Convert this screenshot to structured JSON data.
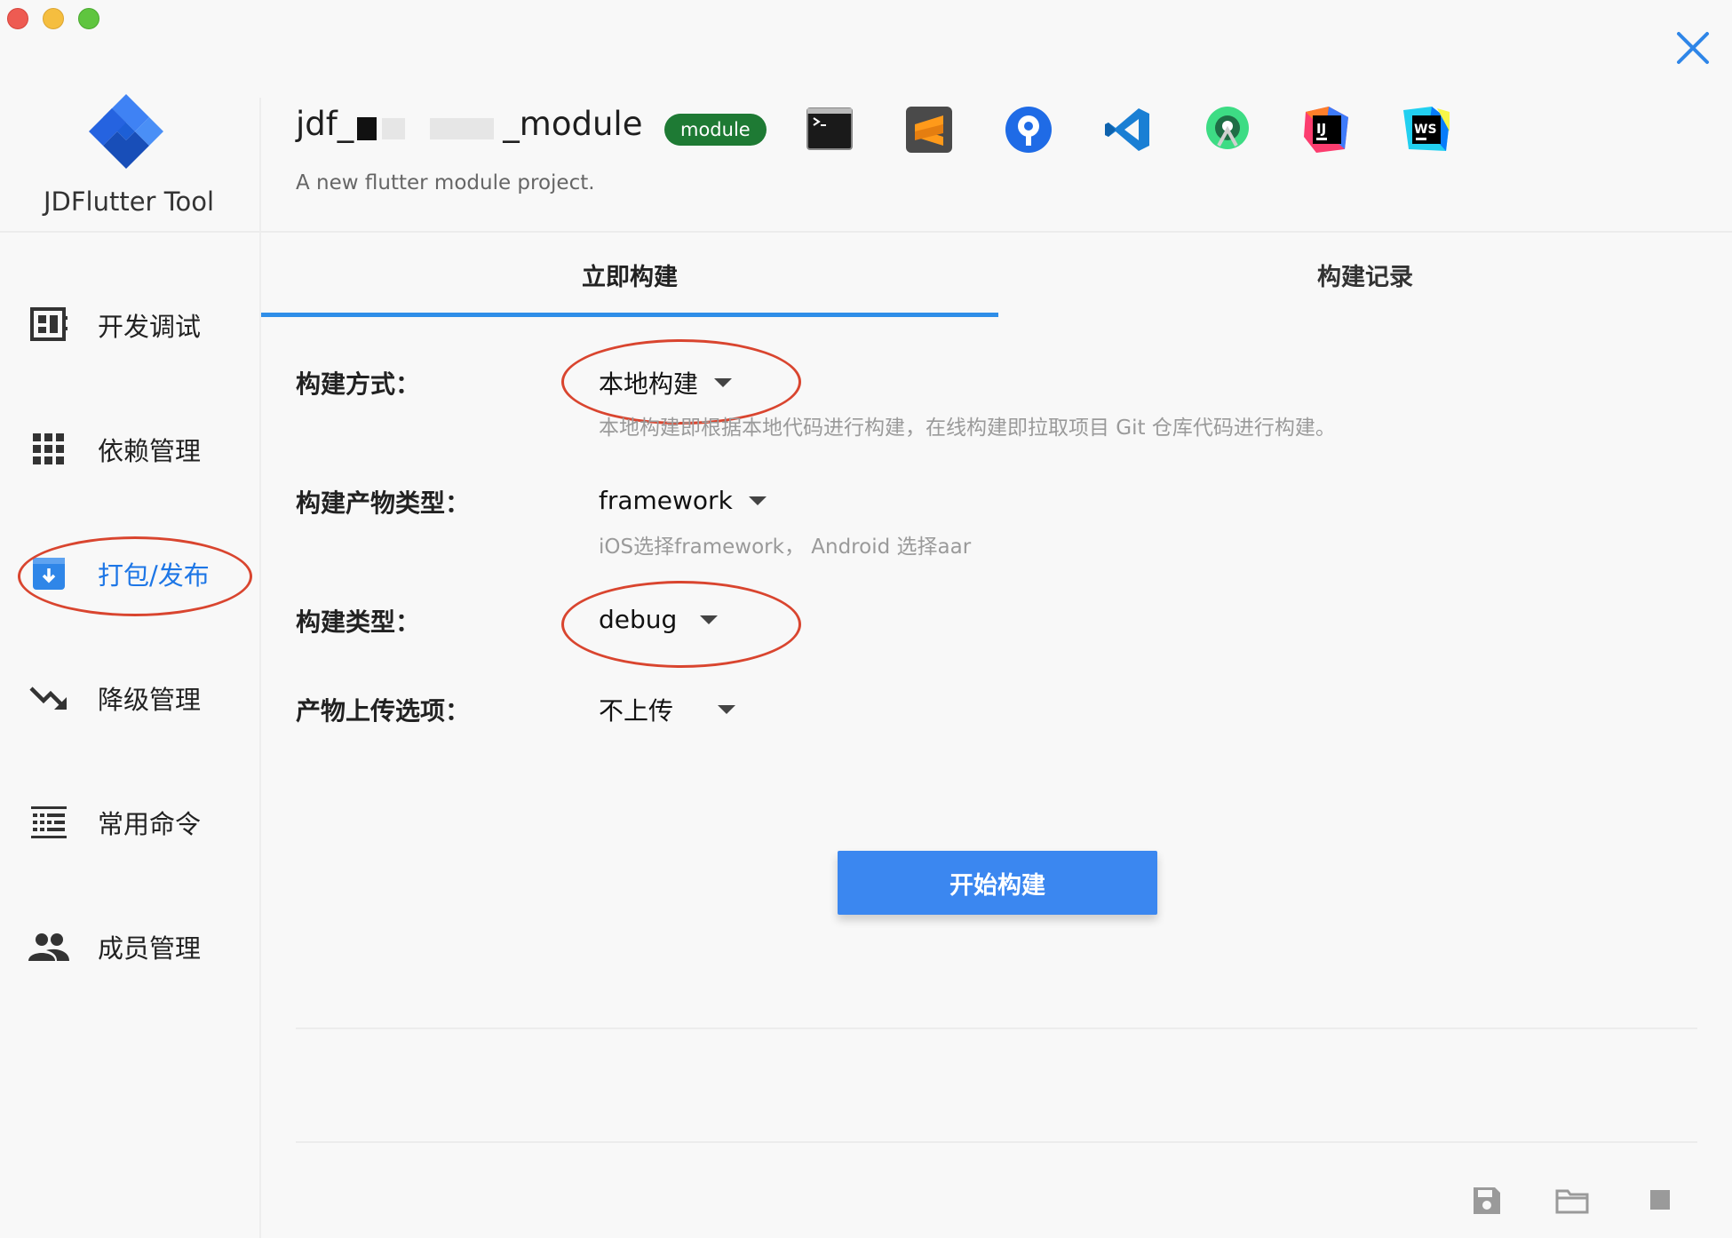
{
  "window": {
    "close_symbol": "✕"
  },
  "app": {
    "name": "JDFlutter Tool"
  },
  "sidebar": {
    "items": [
      {
        "label": "开发调试",
        "icon": "dashboard-icon"
      },
      {
        "label": "依赖管理",
        "icon": "grid-icon"
      },
      {
        "label": "打包/发布",
        "icon": "archive-icon",
        "active": true
      },
      {
        "label": "降级管理",
        "icon": "trending-down-icon"
      },
      {
        "label": "常用命令",
        "icon": "command-list-icon"
      },
      {
        "label": "成员管理",
        "icon": "people-icon"
      }
    ]
  },
  "project": {
    "title_prefix": "jdf_",
    "title_suffix": "_module",
    "badge": "module",
    "description": "A new flutter module project."
  },
  "toolbar": {
    "tools": [
      "terminal-icon",
      "sublime-text-icon",
      "sourcetree-icon",
      "vscode-icon",
      "android-studio-icon",
      "intellij-idea-icon",
      "webstorm-icon"
    ],
    "ij_text": "IJ",
    "ws_text": "WS"
  },
  "tabs": [
    {
      "label": "立即构建",
      "active": true
    },
    {
      "label": "构建记录",
      "active": false
    }
  ],
  "form": {
    "build_method": {
      "label": "构建方式：",
      "value": "本地构建",
      "hint": "本地构建即根据本地代码进行构建，在线构建即拉取项目 Git 仓库代码进行构建。"
    },
    "artifact_type": {
      "label": "构建产物类型：",
      "value": "framework",
      "hint": "iOS选择framework， Android 选择aar"
    },
    "build_type": {
      "label": "构建类型：",
      "value": "debug"
    },
    "upload_option": {
      "label": "产物上传选项：",
      "value": "不上传"
    }
  },
  "actions": {
    "start_build": "开始构建"
  },
  "bottom_icons": [
    "save-icon",
    "folder-icon",
    "stop-icon"
  ],
  "colors": {
    "accent": "#3b87f0",
    "active_nav": "#1d76e6",
    "badge": "#1e7a34",
    "annotation": "#d9452f"
  }
}
